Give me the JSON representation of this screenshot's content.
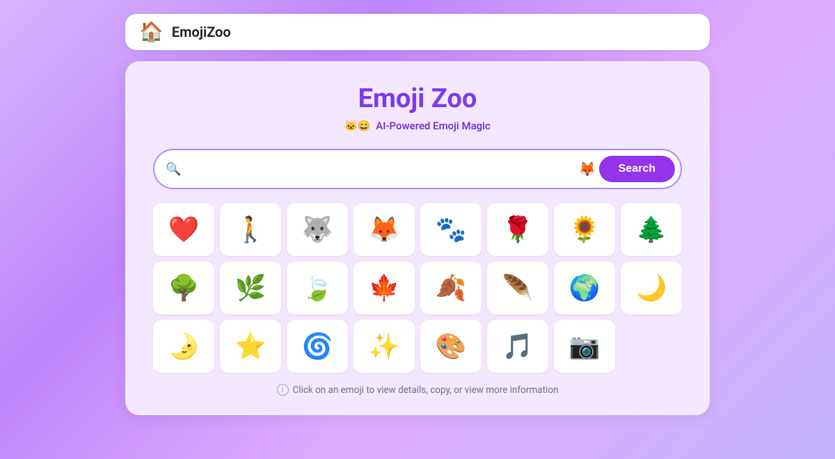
{
  "navbar": {
    "logo": "🏠",
    "title": "EmojiZoo"
  },
  "header": {
    "title": "Emoji Zoo",
    "subtitle_emojis": "🐱😄",
    "subtitle_text": "AI-Powered Emoji Magic"
  },
  "search": {
    "placeholder": "",
    "hint_emoji": "🦊",
    "button_label": "Search"
  },
  "emojis": {
    "row1": [
      "❤️",
      "🚶",
      "🐺",
      "🦊",
      "🐾",
      "🌹",
      "🌻",
      "🌲"
    ],
    "row2": [
      "🌳",
      "🌿",
      "🍃",
      "🍁",
      "🍂",
      "🪶",
      "🌍",
      "🌙"
    ],
    "row3": [
      "🌛",
      "⭐",
      "🌀",
      "✨",
      "🎨",
      "🎵",
      "📷"
    ]
  },
  "footer": {
    "hint": "Click on an emoji to view details, copy, or view more information"
  }
}
